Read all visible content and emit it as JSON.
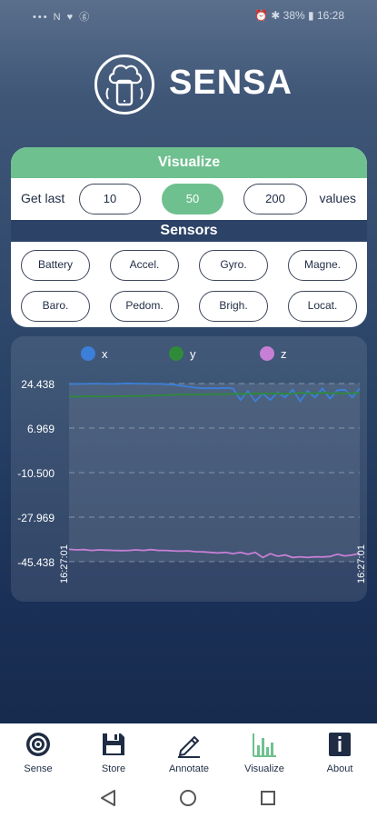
{
  "status": {
    "left_icons": "••• N ♥ ⓖ",
    "battery": "38%",
    "time": "16:28"
  },
  "app": {
    "name": "SENSA"
  },
  "visualize": {
    "title": "Visualize",
    "get_last_label": "Get last",
    "options": [
      "10",
      "50",
      "200"
    ],
    "selected": "50",
    "values_label": "values"
  },
  "sensors": {
    "title": "Sensors",
    "items": [
      "Battery",
      "Accel.",
      "Gyro.",
      "Magne.",
      "Baro.",
      "Pedom.",
      "Brigh.",
      "Locat."
    ]
  },
  "chart_data": {
    "type": "line",
    "legend": [
      "x",
      "y",
      "z"
    ],
    "colors": {
      "x": "#3c7fd9",
      "y": "#2f8a3a",
      "z": "#c77fd6"
    },
    "y_ticks": [
      "24.438",
      "6.969",
      "-10.500",
      "-27.969",
      "-45.438"
    ],
    "ylim": [
      -45.438,
      24.438
    ],
    "x_tick_labels": [
      "16:27:01",
      "16:27:01"
    ],
    "grid": "horizontal dashed",
    "series": [
      {
        "name": "x",
        "values": [
          24.2,
          24.3,
          24.3,
          24.4,
          24.4,
          24.3,
          24.3,
          24.4,
          24.5,
          24.4,
          24.4,
          24.3,
          24.3,
          24.2,
          24.0,
          23.6,
          23.2,
          22.8,
          22.6,
          22.6,
          22.6,
          22.7,
          22.5,
          18.0,
          21.5,
          17.5,
          20.5,
          18.0,
          21.0,
          19.0,
          22.0,
          17.5,
          21.5,
          19.0,
          22.5,
          18.5,
          21.8,
          22.0,
          19.0,
          22.5
        ]
      },
      {
        "name": "y",
        "values": [
          19.3,
          19.3,
          19.4,
          19.5,
          19.4,
          19.3,
          19.4,
          19.5,
          19.5,
          19.6,
          19.6,
          19.7,
          19.8,
          19.9,
          20.0,
          20.1,
          20.1,
          20.2,
          20.2,
          20.3,
          20.3,
          20.3,
          20.4,
          20.4,
          20.4,
          20.6,
          20.4,
          20.5,
          20.6,
          20.4,
          20.5,
          20.8,
          20.6,
          20.7,
          20.8,
          20.6,
          20.7,
          20.6,
          20.7,
          20.8
        ]
      },
      {
        "name": "z",
        "values": [
          -40.6,
          -40.8,
          -40.7,
          -41.0,
          -40.8,
          -40.9,
          -41.0,
          -41.1,
          -41.0,
          -40.8,
          -41.0,
          -40.7,
          -41.0,
          -41.0,
          -41.2,
          -41.3,
          -41.2,
          -41.5,
          -41.6,
          -41.8,
          -42.0,
          -41.8,
          -42.3,
          -41.8,
          -42.5,
          -41.8,
          -43.8,
          -42.3,
          -43.3,
          -42.8,
          -43.8,
          -43.5,
          -43.8,
          -43.5,
          -43.6,
          -43.4,
          -42.5,
          -43.2,
          -42.8,
          -42.2
        ]
      }
    ]
  },
  "nav": [
    {
      "label": "Sense",
      "icon": "target-icon"
    },
    {
      "label": "Store",
      "icon": "save-icon"
    },
    {
      "label": "Annotate",
      "icon": "pencil-icon"
    },
    {
      "label": "Visualize",
      "icon": "bar-chart-icon"
    },
    {
      "label": "About",
      "icon": "info-icon"
    }
  ]
}
